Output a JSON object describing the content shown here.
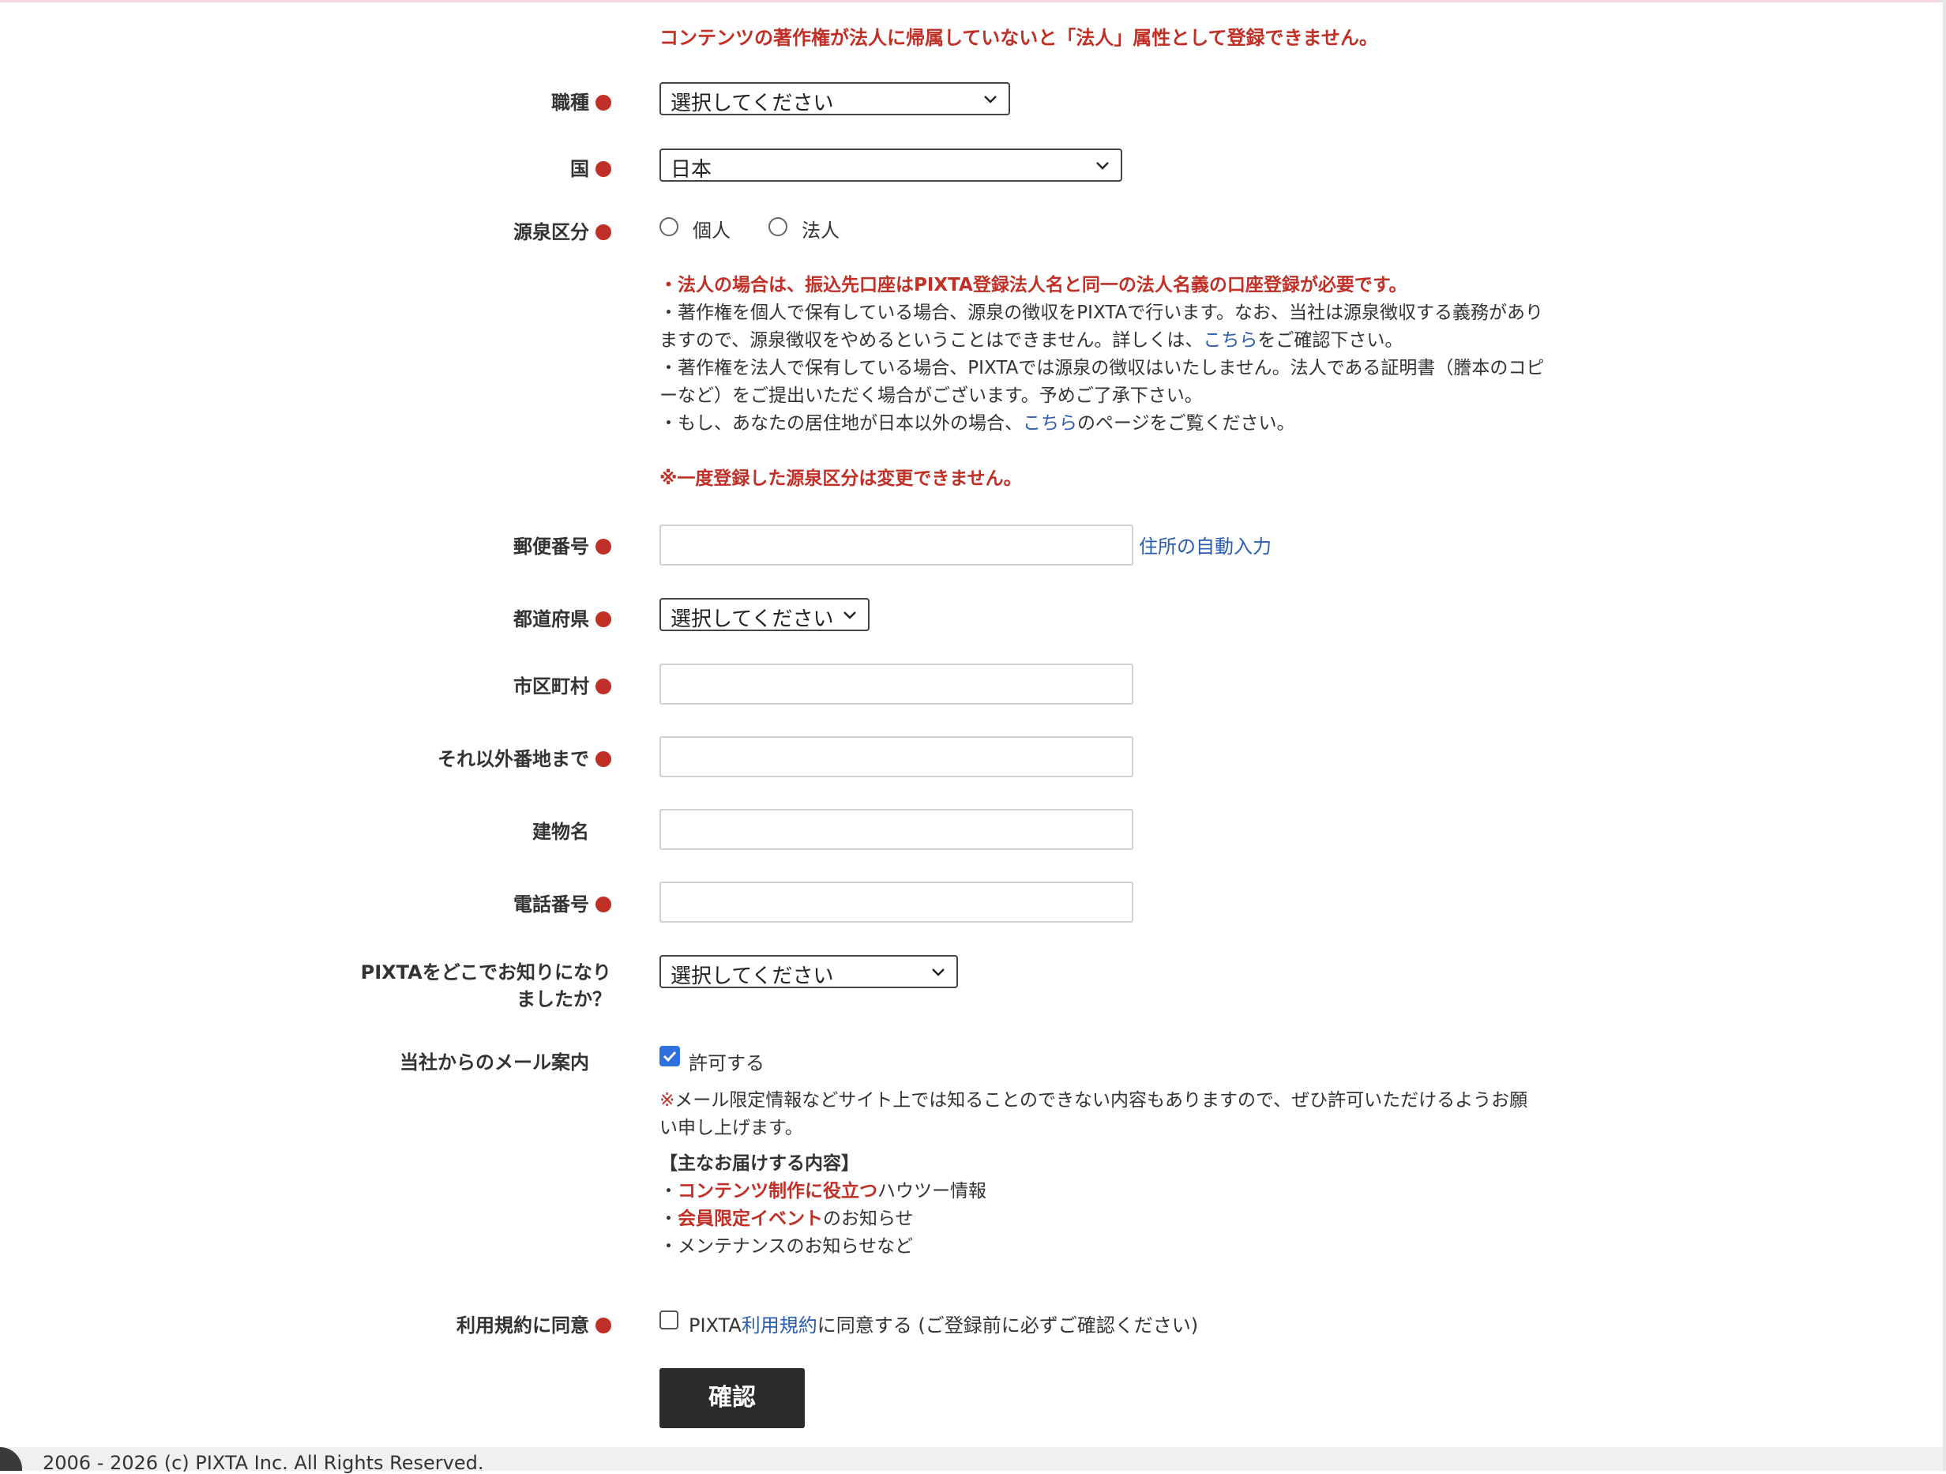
{
  "notice_top": "コンテンツの著作権が法人に帰属していないと「法人」属性として登録できません。",
  "fields": {
    "occupation": {
      "label": "職種",
      "value": "選択してください"
    },
    "country": {
      "label": "国",
      "value": "日本"
    },
    "withholding": {
      "label": "源泉区分",
      "option_individual": "個人",
      "option_corporate": "法人"
    },
    "postal": {
      "label": "郵便番号",
      "autofill_link": "住所の自動入力",
      "value": ""
    },
    "prefecture": {
      "label": "都道府県",
      "value": "選択してください"
    },
    "city": {
      "label": "市区町村",
      "value": ""
    },
    "street": {
      "label": "それ以外番地まで",
      "value": ""
    },
    "building": {
      "label": "建物名",
      "value": ""
    },
    "phone": {
      "label": "電話番号",
      "value": ""
    },
    "referral": {
      "label_line1": "PIXTAをどこでお知りになり",
      "label_line2": "ましたか？",
      "value": "選択してください"
    },
    "mail": {
      "label": "当社からのメール案内",
      "checkbox_label": "許可する",
      "checked": true
    },
    "terms": {
      "label": "利用規約に同意",
      "prefix": "PIXTA",
      "link": "利用規約",
      "suffix": "に同意する (ご登録前に必ずご確認ください)",
      "checked": false
    }
  },
  "withholding_notes": {
    "corporate_warning": "・法人の場合は、振込先口座はPIXTA登録法人名と同一の法人名義の口座登録が必要です。",
    "individual_a": "・著作権を個人で保有している場合、源泉の徴収をPIXTAで行います。なお、当社は源泉徴収する義務があり",
    "individual_b": "ますので、源泉徴収をやめるということはできません。詳しくは、",
    "individual_link": "こちら",
    "individual_c": "をご確認下さい。",
    "corporate_a": "・著作権を法人で保有している場合、PIXTAでは源泉の徴収はいたしません。法人である証明書（謄本のコピ",
    "corporate_b": "ーなど）をご提出いただく場合がございます。予めご了承下さい。",
    "overseas_a": "・もし、あなたの居住地が日本以外の場合、",
    "overseas_link": "こちら",
    "overseas_b": "のページをご覧ください。",
    "final_warning": "※一度登録した源泉区分は変更できません。"
  },
  "mail_notes": {
    "mark": "※",
    "text_a": "メール限定情報などサイト上では知ることのできない内容もありますので、ぜひ許可いただけるようお願",
    "text_b": "い申し上げます。",
    "heading": "【主なお届けする内容】",
    "item1_bullet": "・",
    "item1_red": "コンテンツ制作に役立つ",
    "item1_rest": "ハウツー情報",
    "item2_bullet": "・",
    "item2_red": "会員限定イベント",
    "item2_rest": "のお知らせ",
    "item3": "・メンテナンスのお知らせなど"
  },
  "submit_label": "確認",
  "footer": "2006 - 2026 (c) PIXTA Inc. All Rights Reserved.",
  "colors": {
    "accent_red": "#c03027",
    "link_blue": "#2a5db0",
    "button_dark": "#2b2b2b",
    "checkbox_blue": "#2f6fde"
  }
}
